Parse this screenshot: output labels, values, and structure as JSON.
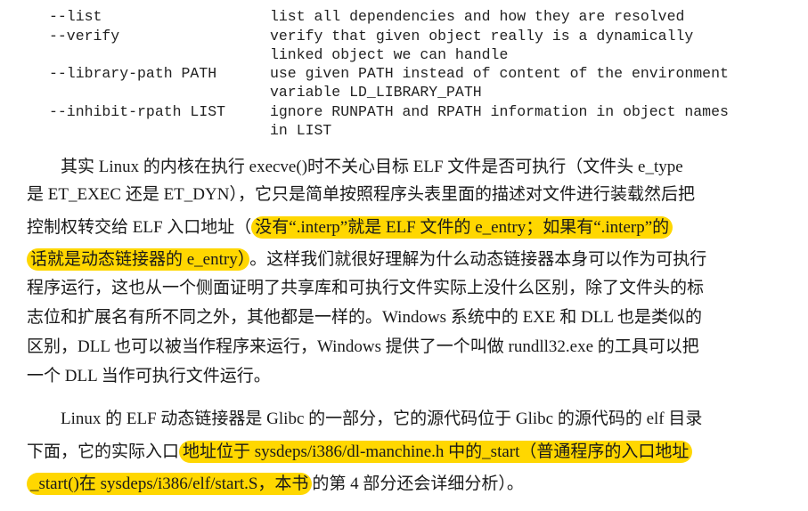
{
  "options": [
    {
      "name": "--list",
      "desc": [
        "list all dependencies and how they are resolved"
      ]
    },
    {
      "name": "--verify",
      "desc": [
        "verify that given object really is a dynamically",
        "linked object we can handle"
      ]
    },
    {
      "name": "--library-path PATH",
      "desc": [
        "use given PATH instead of content of the environment",
        "variable LD_LIBRARY_PATH"
      ]
    },
    {
      "name": "--inhibit-rpath LIST",
      "desc": [
        "ignore RUNPATH and RPATH information in object names",
        "in LIST"
      ]
    }
  ],
  "paragraph1": {
    "line1": "　　其实 Linux 的内核在执行 execve()时不关心目标 ELF 文件是否可执行（文件头 e_type",
    "line2": "是 ET_EXEC 还是 ET_DYN），它只是简单按照程序头表里面的描述对文件进行装载然后把",
    "line3_plain": "控制权转交给 ELF 入口地址（",
    "line3_hl": "没有“.interp”就是 ELF 文件的 e_entry；如果有“.interp”的",
    "line4_hl": "话就是动态链接器的 e_entry）",
    "line4_plain": "。这样我们就很好理解为什么动态链接器本身可以作为可执行",
    "line5": "程序运行，这也从一个侧面证明了共享库和可执行文件实际上没什么区别，除了文件头的标",
    "line6": "志位和扩展名有所不同之外，其他都是一样的。Windows 系统中的 EXE 和 DLL 也是类似的",
    "line7": "区别，DLL 也可以被当作程序来运行，Windows 提供了一个叫做 rundll32.exe 的工具可以把",
    "line8": "一个 DLL 当作可执行文件运行。"
  },
  "paragraph2": {
    "line1": "　　Linux 的 ELF 动态链接器是 Glibc 的一部分，它的源代码位于 Glibc 的源代码的 elf 目录",
    "line2_plain": "下面，它的实际入口",
    "line2_hl": "地址位于 sysdeps/i386/dl-manchine.h 中的_start（普通程序的入口地址",
    "line3_hl": "_start()在 sysdeps/i386/elf/start.S，本书",
    "line3_plain": "的第 4 部分还会详细分析）。"
  }
}
